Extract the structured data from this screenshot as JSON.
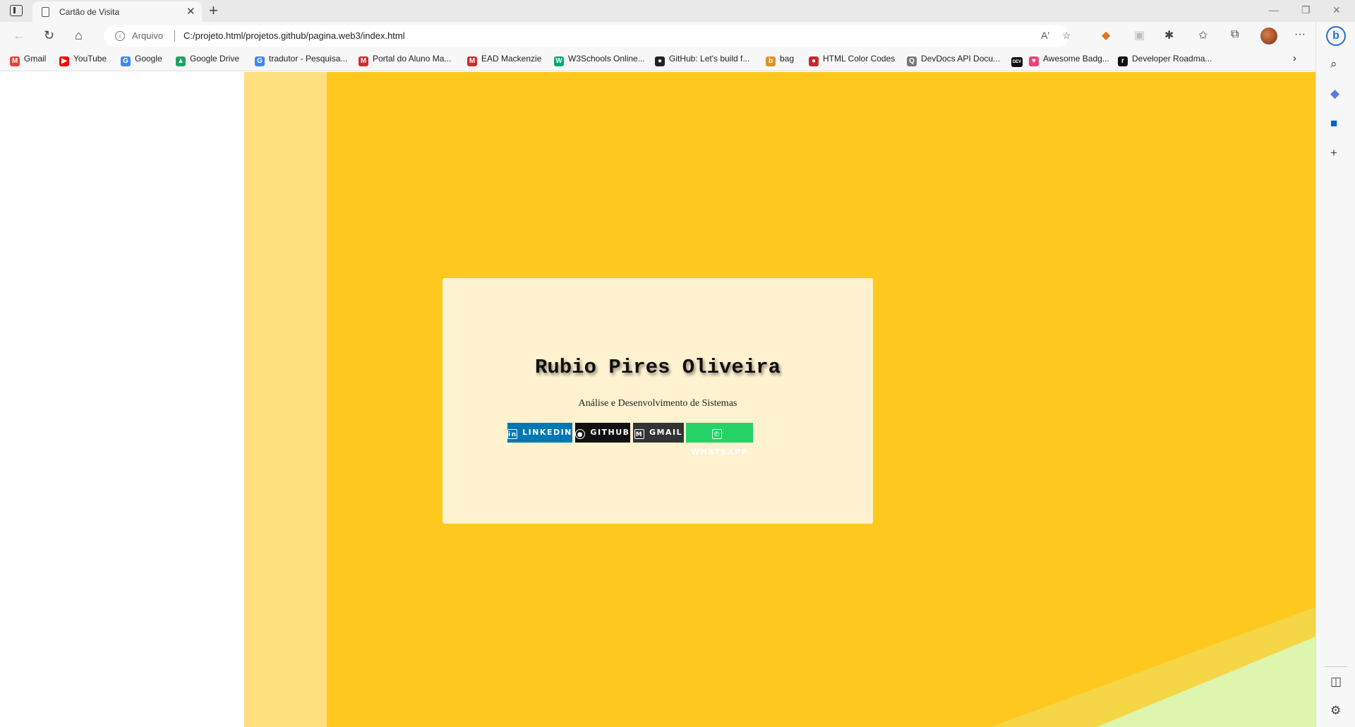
{
  "browser": {
    "tab_title": "Cartão de Visita",
    "tab_close": "✕",
    "new_tab": "+",
    "security_label": "Arquivo",
    "url": "C:/projeto.html/projetos.github/pagina.web3/index.html",
    "read_aloud": "Aʹ",
    "bing": "b"
  },
  "bookmarks": [
    {
      "label": "Gmail",
      "icon": "M",
      "color": "#ea4335"
    },
    {
      "label": "YouTube",
      "icon": "▶",
      "color": "#ff0000"
    },
    {
      "label": "Google",
      "icon": "G",
      "color": "#4285f4"
    },
    {
      "label": "Google Drive",
      "icon": "▲",
      "color": "#1fa463"
    },
    {
      "label": "tradutor - Pesquisa...",
      "icon": "G",
      "color": "#4285f4"
    },
    {
      "label": "Portal do Aluno Ma...",
      "icon": "M",
      "color": "#d42a2a"
    },
    {
      "label": "EAD Mackenzie",
      "icon": "M",
      "color": "#d42a2a"
    },
    {
      "label": "W3Schools Online...",
      "icon": "W",
      "color": "#04aa6d"
    },
    {
      "label": "GitHub: Let's build f...",
      "icon": "●",
      "color": "#222222"
    },
    {
      "label": "bag",
      "icon": "b",
      "color": "#e0902a"
    },
    {
      "label": "HTML Color Codes",
      "icon": "●",
      "color": "#c62828"
    },
    {
      "label": "DevDocs API Docu...",
      "icon": "Q",
      "color": "#777777"
    },
    {
      "label": "",
      "icon": "DEV",
      "color": "#111111"
    },
    {
      "label": "Awesome Badg...",
      "icon": "♥",
      "color": "#e8457a"
    },
    {
      "label": "Developer Roadma...",
      "icon": "r",
      "color": "#111111"
    }
  ],
  "card": {
    "name": "Rubio Pires Oliveira",
    "role": "Análise e Desenvolvimento de Sistemas",
    "badges": [
      {
        "label": "LINKEDIN",
        "icon": "in",
        "color": "#0077b5"
      },
      {
        "label": "GITHUB",
        "icon": "●",
        "color": "#121011"
      },
      {
        "label": "GMAIL",
        "icon": "M",
        "color": "#333333"
      },
      {
        "label": "WHATSAPP",
        "icon": "✆",
        "color": "#25d366"
      }
    ]
  },
  "colors": {
    "page_background": "#fec81f",
    "left_stripe": "#fddf7f",
    "card_background": "#fef2d0",
    "corner_light": "#f5d646",
    "corner_green": "#ddf5ad"
  }
}
